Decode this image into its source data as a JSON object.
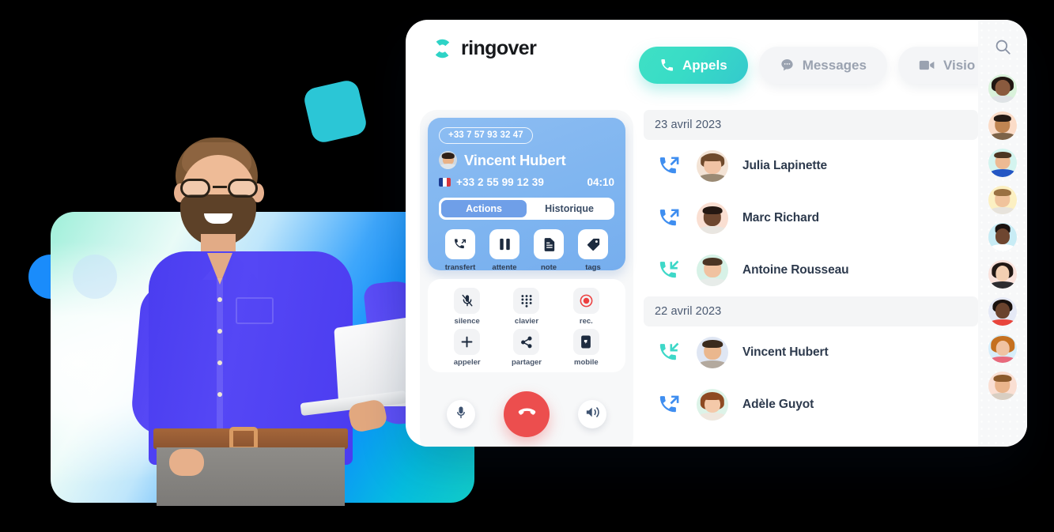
{
  "brand": {
    "name": "ringover",
    "accent_teal": "#34d2c8",
    "accent_blue": "#3f8ef0",
    "danger_red": "#ec4e4e"
  },
  "header": {
    "tabs": [
      {
        "label": "Appels",
        "icon": "phone-icon",
        "active": true
      },
      {
        "label": "Messages",
        "icon": "chat-bubble-icon",
        "active": false
      },
      {
        "label": "Visio",
        "icon": "video-camera-icon",
        "active": false
      }
    ]
  },
  "call_panel": {
    "caller_pill_number": "+33 7 57 93 32 47",
    "caller_name": "Vincent Hubert",
    "dialed_number": "+33 2 55 99 12 39",
    "country_flag": "fr-flag-icon",
    "timer": "04:10",
    "segments": [
      {
        "label": "Actions",
        "active": true
      },
      {
        "label": "Historique",
        "active": false
      }
    ],
    "actions": [
      {
        "label": "transfert",
        "icon": "call-transfer-icon"
      },
      {
        "label": "attente",
        "icon": "pause-icon"
      },
      {
        "label": "note",
        "icon": "note-document-icon"
      },
      {
        "label": "tags",
        "icon": "tag-icon"
      }
    ],
    "pad": [
      {
        "label": "silence",
        "icon": "microphone-muted-icon"
      },
      {
        "label": "clavier",
        "icon": "dialpad-icon"
      },
      {
        "label": "rec.",
        "icon": "record-icon"
      },
      {
        "label": "appeler",
        "icon": "plus-icon"
      },
      {
        "label": "partager",
        "icon": "share-icon"
      },
      {
        "label": "mobile",
        "icon": "mobile-phone-icon"
      }
    ],
    "controls": {
      "mic": "microphone-icon",
      "hangup": "hangup-phone-icon",
      "speaker": "speaker-icon"
    }
  },
  "call_list": {
    "groups": [
      {
        "date": "23 avril 2023",
        "calls": [
          {
            "name": "Julia Lapinette",
            "direction": "outgoing",
            "direction_icon": "call-outgoing-icon",
            "avatar_bg": "#f3e3d5",
            "skin": "#f0c3a4",
            "hair": "#6f4a2c",
            "shirt": "#9a8a74"
          },
          {
            "name": "Marc Richard",
            "direction": "outgoing",
            "direction_icon": "call-outgoing-icon",
            "avatar_bg": "#fadfd2",
            "skin": "#6d4730",
            "hair": "#241812",
            "shirt": "#e9e6e1"
          },
          {
            "name": "Antoine Rousseau",
            "direction": "incoming",
            "direction_icon": "call-incoming-icon",
            "avatar_bg": "#d7f2e7",
            "skin": "#f0c2a0",
            "hair": "#4a3524",
            "shirt": "#e7ece9"
          }
        ]
      },
      {
        "date": "22 avril 2023",
        "calls": [
          {
            "name": "Vincent Hubert",
            "direction": "incoming",
            "direction_icon": "call-incoming-icon",
            "avatar_bg": "#dfe6f3",
            "skin": "#eab78e",
            "hair": "#3a2a1c",
            "shirt": "#b3a99e"
          },
          {
            "name": "Adèle Guyot",
            "direction": "outgoing",
            "direction_icon": "call-outgoing-icon",
            "avatar_bg": "#ddf3e8",
            "skin": "#f4c9a9",
            "hair": "#8e4a22",
            "shirt": "#efe7de"
          }
        ]
      }
    ],
    "outgoing_color": "#3f8ef0",
    "incoming_color": "#3ed8c8"
  },
  "contacts_sidebar": {
    "search_icon": "search-icon",
    "avatars": [
      {
        "name": "contact-1",
        "bg": "#d9f2da",
        "skin": "#8a5a3e",
        "hair": "#211612",
        "shirt": "#dfe3e6"
      },
      {
        "name": "contact-2",
        "bg": "#fbdcc8",
        "skin": "#c08552",
        "hair": "#241a14",
        "shirt": "#7d6348"
      },
      {
        "name": "contact-3",
        "bg": "#d4f4ef",
        "skin": "#edba93",
        "hair": "#4c3522",
        "shirt": "#2356c4"
      },
      {
        "name": "contact-4",
        "bg": "#fcf0c2",
        "skin": "#f0c39c",
        "hair": "#9a7142",
        "shirt": "#e7e3dc"
      },
      {
        "name": "contact-5",
        "bg": "#c8ecf5",
        "skin": "#6e4630",
        "hair": "#1b1310",
        "shirt": "#ffffff"
      },
      {
        "name": "contact-6",
        "bg": "#fae3dd",
        "skin": "#f3cfb2",
        "hair": "#211713",
        "shirt": "#2c2c30"
      },
      {
        "name": "contact-7",
        "bg": "#e5e9f6",
        "skin": "#6a432e",
        "hair": "#19110e",
        "shirt": "#e8453c"
      },
      {
        "name": "contact-8",
        "bg": "#d7eefa",
        "skin": "#f0c3a2",
        "hair": "#c5701f",
        "shirt": "#e8697c"
      },
      {
        "name": "contact-9",
        "bg": "#fadfd3",
        "skin": "#eab58c",
        "hair": "#8b5a2c",
        "shirt": "#d8cec2"
      }
    ]
  }
}
